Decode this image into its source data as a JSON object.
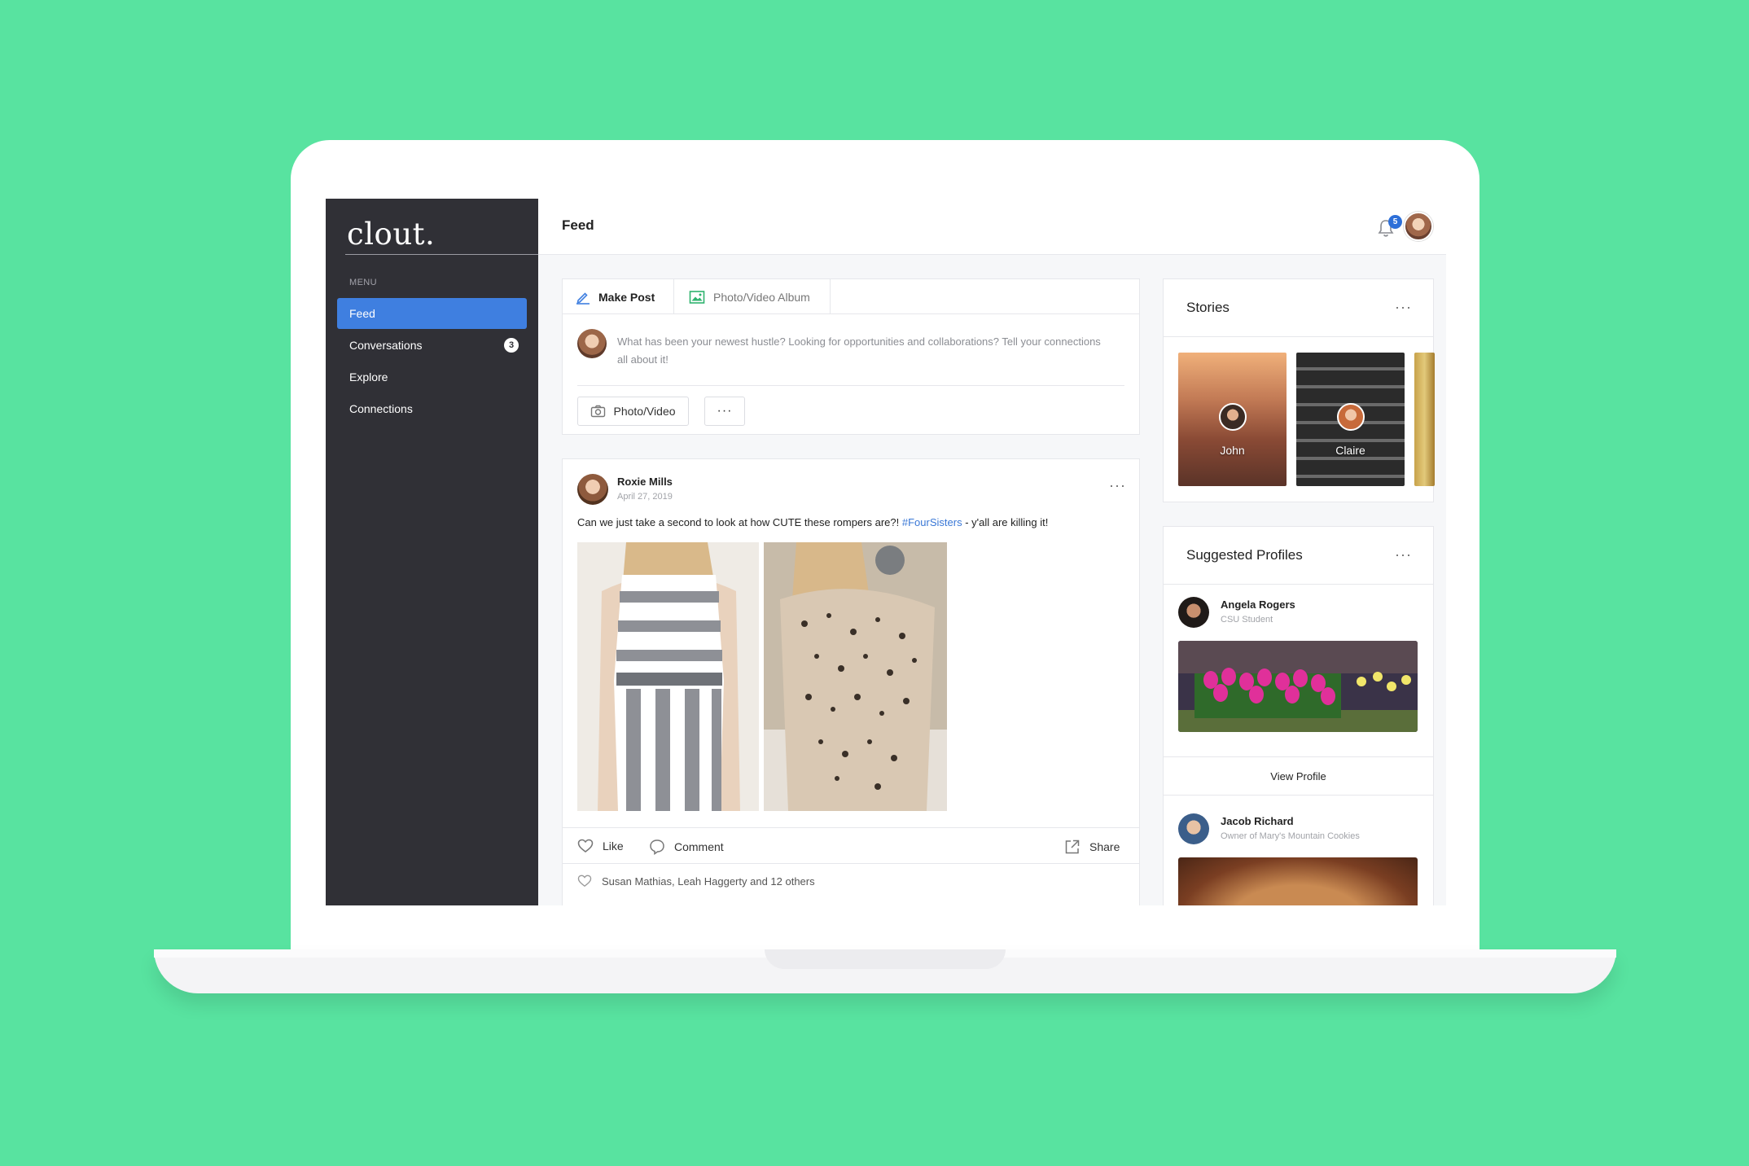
{
  "app": {
    "logo": "clout.",
    "page_title": "Feed",
    "notification_count": "5"
  },
  "sidebar": {
    "menu_label": "MENU",
    "items": [
      {
        "label": "Feed",
        "active": true,
        "badge": ""
      },
      {
        "label": "Conversations",
        "active": false,
        "badge": "3"
      },
      {
        "label": "Explore",
        "active": false,
        "badge": ""
      },
      {
        "label": "Connections",
        "active": false,
        "badge": ""
      }
    ]
  },
  "composer": {
    "tab_make_post": "Make Post",
    "tab_album": "Photo/Video Album",
    "prompt": "What has been your newest hustle? Looking for opportunities and collaborations? Tell your connections all about it!",
    "photo_button": "Photo/Video",
    "more_button": "···"
  },
  "post": {
    "author": "Roxie Mills",
    "date": "April 27, 2019",
    "text_before": "Can we just take a second to look at how CUTE these rompers are?! ",
    "hashtag": "#FourSisters",
    "text_after": " - y'all are killing it!",
    "more": "···",
    "like_label": "Like",
    "comment_label": "Comment",
    "share_label": "Share",
    "likes_summary": "Susan Mathias, Leah Haggerty and 12 others"
  },
  "stories": {
    "title": "Stories",
    "more": "···",
    "items": [
      {
        "name": "John"
      },
      {
        "name": "Claire"
      }
    ]
  },
  "suggested": {
    "title": "Suggested Profiles",
    "more": "···",
    "profiles": [
      {
        "name": "Angela Rogers",
        "subtitle": "CSU Student"
      },
      {
        "name": "Jacob Richard",
        "subtitle": "Owner of Mary's Mountain Cookies"
      }
    ],
    "view_profile": "View Profile"
  },
  "colors": {
    "background": "#58e3a0",
    "sidebar": "#303036",
    "accent": "#3f7fe0",
    "hashtag": "#3a78d6"
  }
}
